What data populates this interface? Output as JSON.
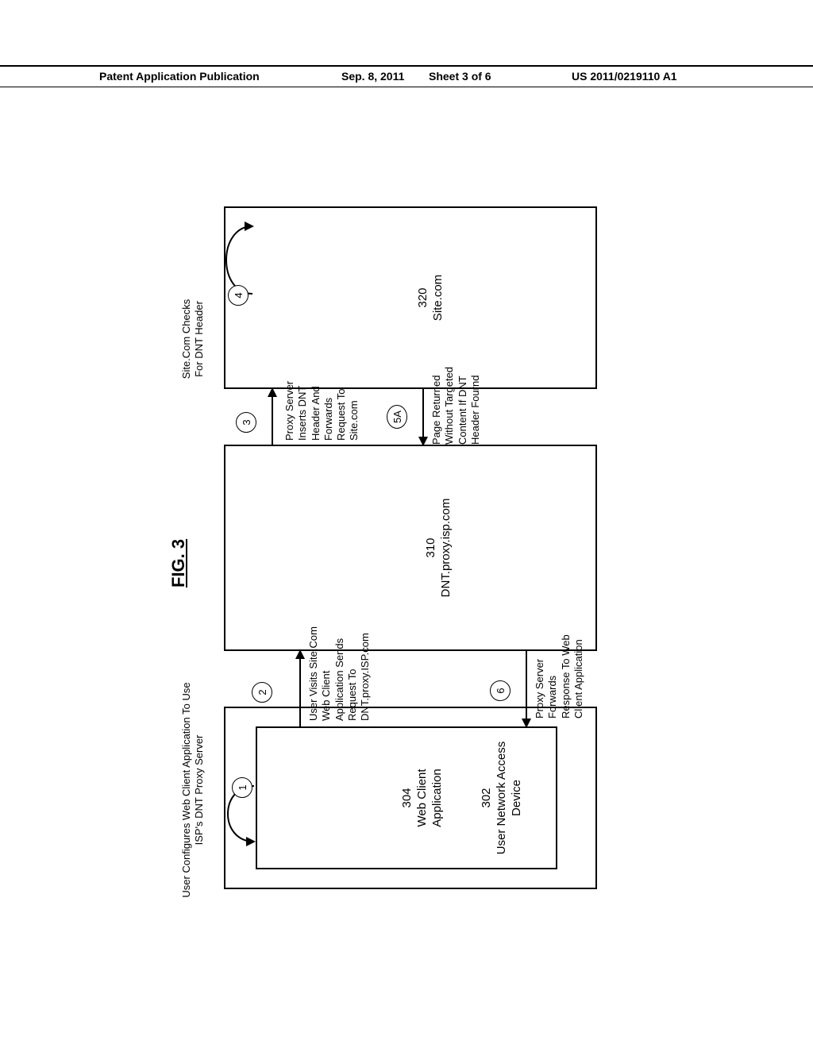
{
  "header": {
    "left": "Patent Application Publication",
    "date": "Sep. 8, 2011",
    "sheet": "Sheet 3 of 6",
    "pubno": "US 2011/0219110 A1"
  },
  "figure": {
    "label": "FIG. 3"
  },
  "boxes": {
    "b302_num": "302",
    "b302_txt": "User Network Access\nDevice",
    "b304_num": "304",
    "b304_txt": "Web Client\nApplication",
    "b310_num": "310",
    "b310_txt": "DNT.proxy.isp.com",
    "b320_num": "320",
    "b320_txt": "Site.com"
  },
  "steps": {
    "s1": "1",
    "s2": "2",
    "s3": "3",
    "s4": "4",
    "s5a": "5A",
    "s6": "6"
  },
  "captions": {
    "c1": "User Configures Web Client Application To\nUse ISP's DNT Proxy Server",
    "c2": "User Visits\nSite.Com\nWeb Client\nApplication Sends\nRequest To\nDNT.proxy.ISP.com",
    "c3": "Proxy Server\nInserts DNT\nHeader And\nForwards\nRequest To\nSite.com",
    "c4": "Site.Com\nChecks For\nDNT Header",
    "c5a": "Page Returned\nWithout Targeted\nContent If DNT\nHeader Fournd",
    "c6": "Proxy Server\nForwards\nResponse To\nWeb Client\nApplication"
  }
}
